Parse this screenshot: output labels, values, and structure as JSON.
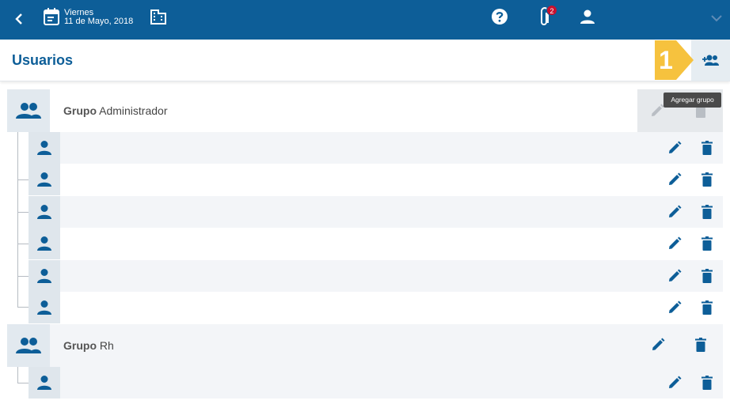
{
  "topbar": {
    "day": "Viernes",
    "date": "11 de Mayo, 2018",
    "attachments_badge": "2"
  },
  "page": {
    "title": "Usuarios",
    "add_group_tooltip": "Agregar grupo",
    "marker_number": "1"
  },
  "groups": [
    {
      "prefix": "Grupo",
      "name": "Administrador",
      "users": 6
    },
    {
      "prefix": "Grupo",
      "name": "Rh",
      "users": 1
    }
  ],
  "colors": {
    "primary": "#0d5e98",
    "marker": "#f6c23e",
    "badge": "#c8102e"
  },
  "icons": [
    "back-icon",
    "calendar-icon",
    "building-icon",
    "help-icon",
    "paperclip-icon",
    "user-icon",
    "chevron-down-icon",
    "add-group-icon",
    "group-icon",
    "edit-icon",
    "delete-icon"
  ]
}
